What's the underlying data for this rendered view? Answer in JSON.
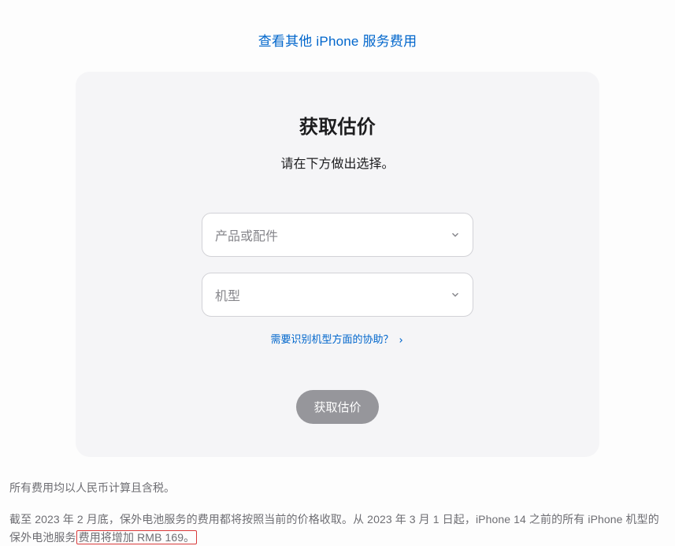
{
  "topLink": {
    "label": "查看其他 iPhone 服务费用"
  },
  "card": {
    "title": "获取估价",
    "subtitle": "请在下方做出选择。",
    "select1": {
      "placeholder": "产品或配件"
    },
    "select2": {
      "placeholder": "机型"
    },
    "helpLink": {
      "label": "需要识别机型方面的协助？"
    },
    "submitButton": {
      "label": "获取估价"
    }
  },
  "footer": {
    "line1": "所有费用均以人民币计算且含税。",
    "line2_part1": "截至 2023 年 2 月底，保外电池服务的费用都将按照当前的价格收取。从 2023 年 3 月 1 日起，iPhone 14 之前的所有 iPhone 机型的保外电池服务",
    "line2_highlight": "费用将增加 RMB 169。"
  }
}
